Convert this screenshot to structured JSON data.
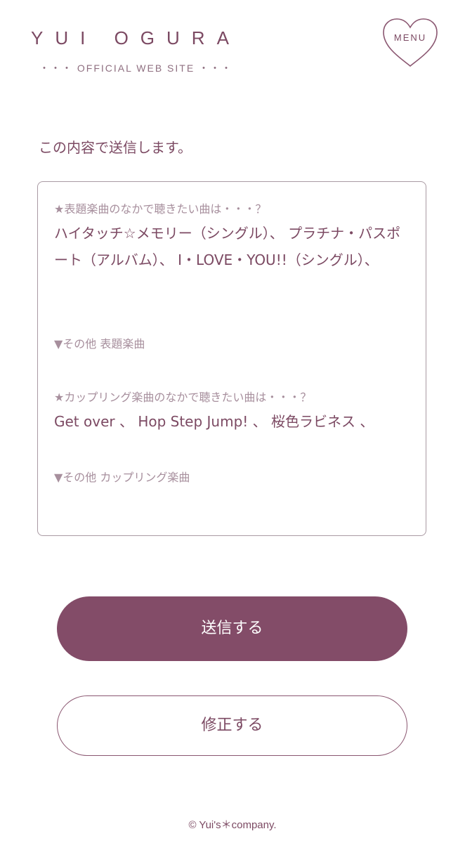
{
  "header": {
    "logo_title": "YUI OGURA",
    "logo_subtitle": "・・・ OFFICIAL WEB SITE ・・・",
    "menu_label": "MENU",
    "menu_icon": "heart-icon"
  },
  "confirm": {
    "intro": "この内容で送信します。",
    "fields": [
      {
        "label": "★表題楽曲のなかで聴きたい曲は・・・？",
        "value": "ハイタッチ☆メモリー（シングル）、 プラチナ・パスポート（アルバム）、 I・LOVE・YOU!!（シングル）、"
      },
      {
        "label": "▼その他 表題楽曲",
        "value": ""
      },
      {
        "label": "★カップリング楽曲のなかで聴きたい曲は・・・？",
        "value": "Get over 、 Hop Step Jump! 、 桜色ラビネス 、"
      },
      {
        "label": "▼その他 カップリング楽曲",
        "value": ""
      }
    ]
  },
  "actions": {
    "submit_label": "送信する",
    "edit_label": "修正する"
  },
  "footer": {
    "copyright": "© Yui's＊company."
  },
  "colors": {
    "accent": "#834c68",
    "text": "#7c4a63",
    "label": "#a78f9d",
    "border": "#a99aa3"
  }
}
